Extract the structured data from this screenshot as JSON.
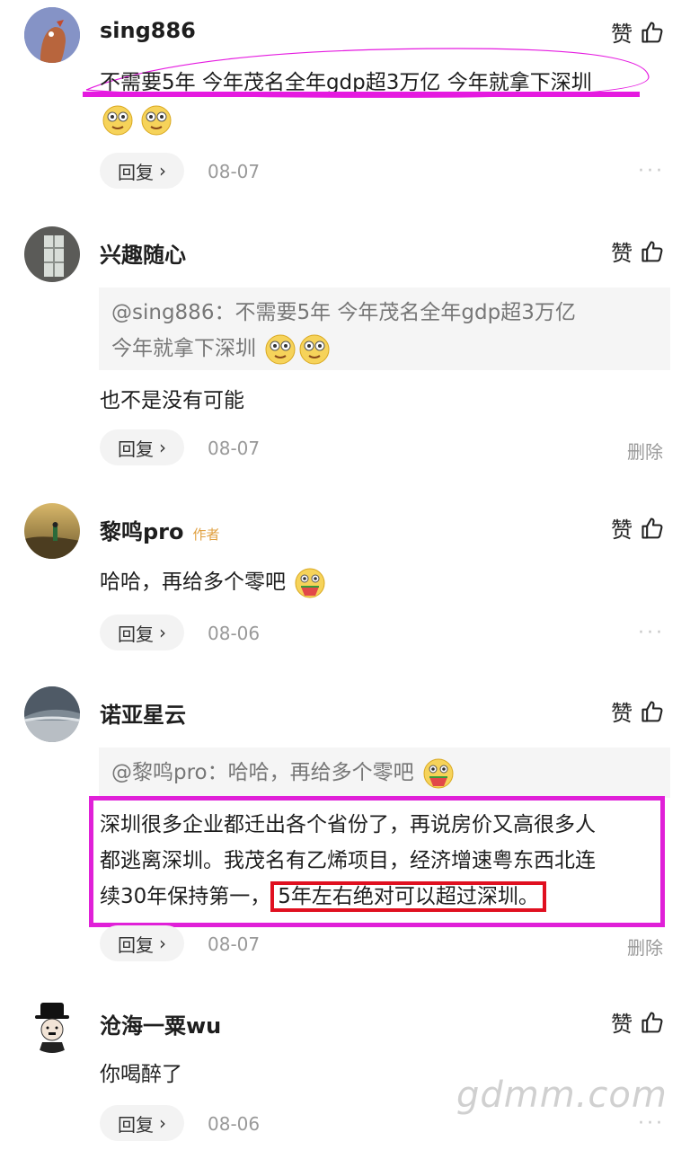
{
  "comments": [
    {
      "username": "sing886",
      "like_label": "赞",
      "text": "不需要5年 今年茂名全年gdp超3万亿 今年就拿下深圳",
      "reply_label": "回复",
      "date": "08-07",
      "more": "···"
    },
    {
      "username": "兴趣随心",
      "like_label": "赞",
      "quote_line1": "@sing886：不需要5年 今年茂名全年gdp超3万亿",
      "quote_line2": "今年就拿下深圳",
      "text": "也不是没有可能",
      "reply_label": "回复",
      "date": "08-07",
      "delete": "删除"
    },
    {
      "username": "黎鸣pro",
      "author_tag": "作者",
      "like_label": "赞",
      "text": "哈哈，再给多个零吧",
      "reply_label": "回复",
      "date": "08-06",
      "more": "···"
    },
    {
      "username": "诺亚星云",
      "like_label": "赞",
      "quote_line1": "@黎鸣pro：哈哈，再给多个零吧",
      "text_line1": "深圳很多企业都迁出各个省份了，再说房价又高很多人",
      "text_line2": "都逃离深圳。我茂名有乙烯项目，经济增速粤东西北连",
      "text_line3a": "续30年保持第一，",
      "text_line3b": "5年左右绝对可以超过深圳。",
      "reply_label": "回复",
      "date": "08-07",
      "delete": "删除"
    },
    {
      "username": "沧海一粟wu",
      "like_label": "赞",
      "text": "你喝醉了",
      "reply_label": "回复",
      "date": "08-06",
      "more": "···"
    }
  ],
  "watermark": "gdmm.com",
  "colors": {
    "highlight": "#e020d8",
    "red_box": "#e01020"
  },
  "icons": [
    "thumbs-up-icon",
    "chevron-right-icon",
    "emoji-drooling-icon",
    "emoji-watermelon-icon"
  ]
}
